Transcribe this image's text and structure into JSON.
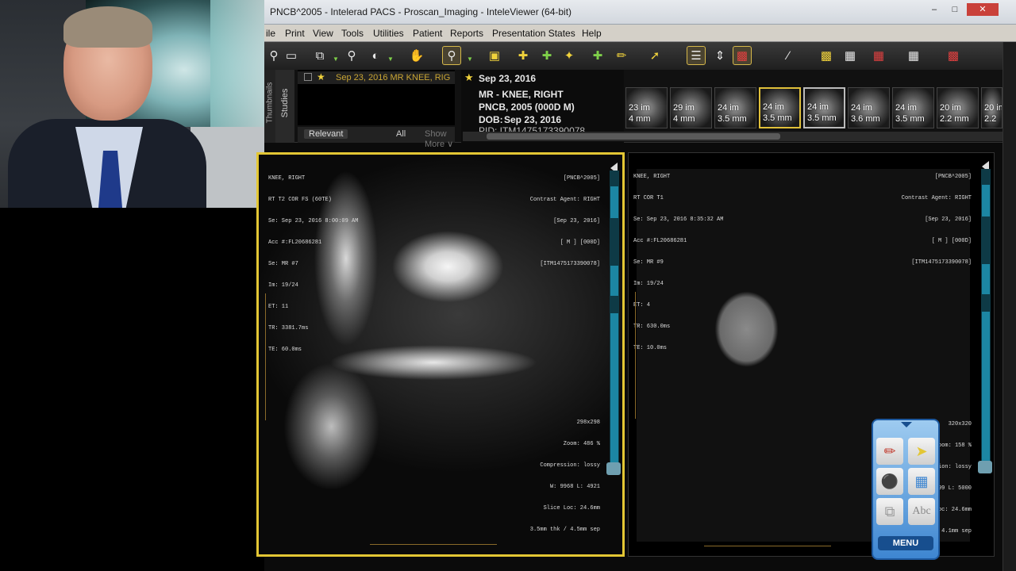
{
  "window": {
    "title": "PNCB^2005 - Intelerad PACS - Proscan_Imaging - InteleViewer (64-bit)",
    "min": "–",
    "max": "□",
    "close": "✕"
  },
  "menu": [
    "ile",
    "Print",
    "View",
    "Tools",
    "Utilities",
    "Patient",
    "Reports",
    "Presentation States",
    "Help"
  ],
  "sidebar": {
    "tab_studies": "Studies",
    "tab_thumbnails": "Thumbnails"
  },
  "study_row": "Sep 23, 2016  MR  KNEE, RIG",
  "filters": {
    "relevant": "Relevant",
    "all": "All",
    "show_more": "Show More ∨"
  },
  "patient": {
    "date": "Sep 23, 2016",
    "exam": "MR - KNEE, RIGHT",
    "name": "PNCB, 2005 (000D M)",
    "dob_label": "DOB:",
    "dob": "Sep 23, 2016",
    "pid": "PID: ITM1475173390078"
  },
  "thumbnails": [
    {
      "label1": "23 im",
      "label2": "4 mm"
    },
    {
      "label1": "29 im",
      "label2": "4 mm"
    },
    {
      "label1": "24 im",
      "label2": "3.5 mm"
    },
    {
      "label1": "24 im",
      "label2": "3.5 mm"
    },
    {
      "label1": "24 im",
      "label2": "3.5 mm"
    },
    {
      "label1": "24 im",
      "label2": "3.6 mm"
    },
    {
      "label1": "24 im",
      "label2": "3.5 mm"
    },
    {
      "label1": "20 im",
      "label2": "2.2 mm"
    },
    {
      "label1": "20 im",
      "label2": "2.2"
    }
  ],
  "viewport_left": {
    "tl": [
      "KNEE, RIGHT",
      "RT T2 COR FS (60TE)",
      "Se: Sep 23, 2016 8:00:09 AM",
      "Acc #:FL20686281",
      "Se: MR #7",
      "Im: 19/24",
      "ET: 11",
      "TR: 3381.7ms",
      "TE: 60.0ms"
    ],
    "tr": [
      "[PNCB^2005]",
      "Contrast Agent: RIGHT",
      "[Sep 23, 2016]",
      "[ M ] [000D]",
      "[ITM1475173390078]"
    ],
    "br": [
      "298x298",
      "Zoom: 486 %",
      "Compression: lossy",
      "W: 9968 L: 4921",
      "Slice Loc: 24.6mm",
      "3.5mm thk / 4.5mm sep"
    ]
  },
  "viewport_right": {
    "tl": [
      "KNEE, RIGHT",
      "RT COR T1",
      "Se: Sep 23, 2016 8:35:32 AM",
      "Acc #:FL20686281",
      "Se: MR #9",
      "Im: 19/24",
      "ET: 4",
      "TR: 630.0ms",
      "TE: 10.0ms"
    ],
    "tr": [
      "[PNCB^2005]",
      "Contrast Agent: RIGHT",
      "[Sep 23, 2016]",
      "[ M ] [000D]",
      "[ITM1475173390078]"
    ],
    "br": [
      "320x320",
      "Zoom: 158 %",
      "ression: lossy",
      "9999 L: 5000",
      "Loc: 24.6mm",
      "/ 4.1mm sep"
    ]
  },
  "float_menu": {
    "menu": "MENU",
    "abc": "Abc"
  },
  "colors": {
    "accent": "#e3c634",
    "scroll": "#1c86a3",
    "menu_blue": "#3e86d1"
  }
}
